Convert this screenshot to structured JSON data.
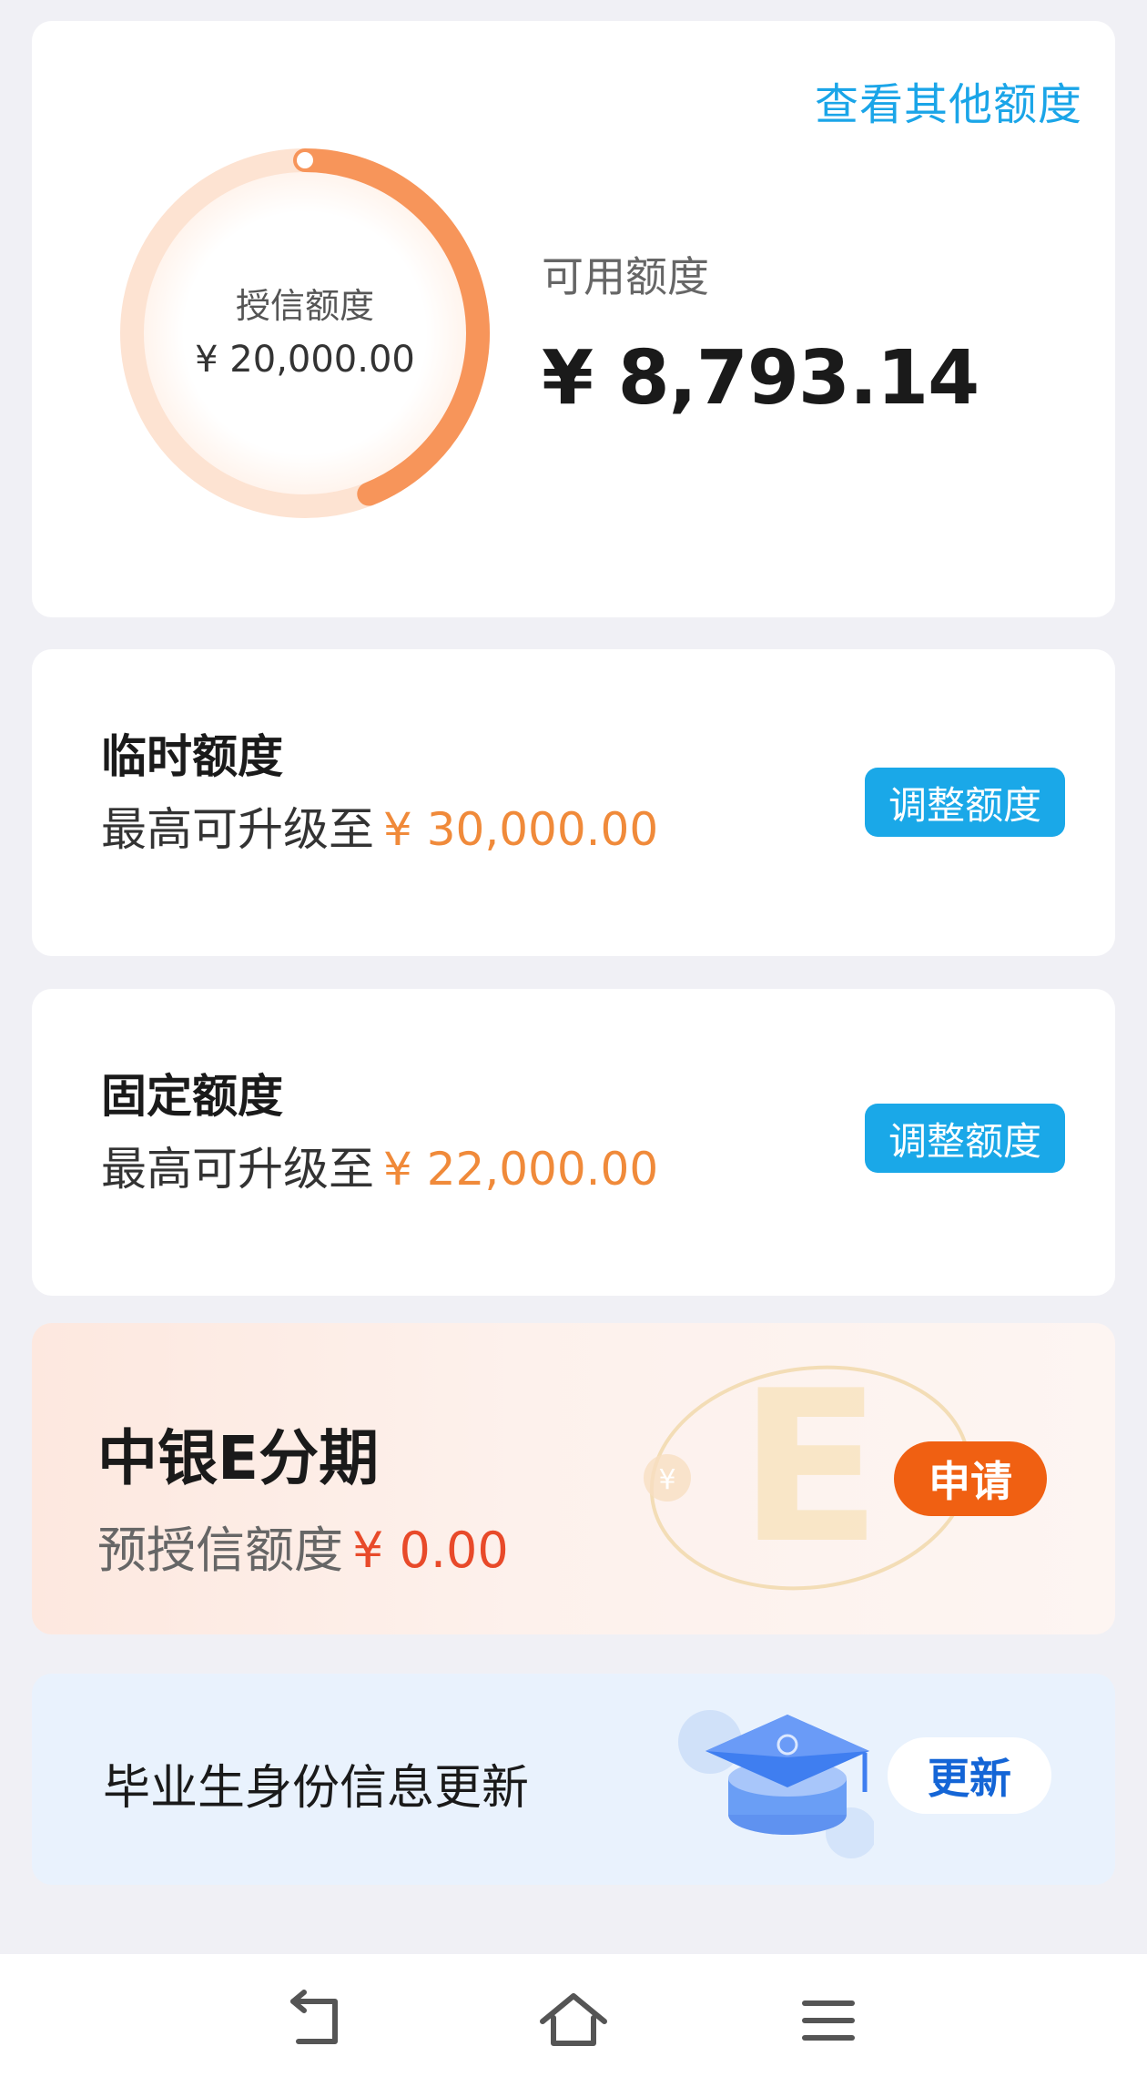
{
  "credit": {
    "other_link": "查看其他额度",
    "credit_label": "授信额度",
    "credit_value": "¥ 20,000.00",
    "available_label": "可用额度",
    "available_value": "¥ 8,793.14",
    "ring_ratio": 0.4397,
    "ring_color": "#f7955a"
  },
  "temp": {
    "title": "临时额度",
    "sub_label": "最高可升级至",
    "amount": "¥ 30,000.00",
    "button": "调整额度"
  },
  "fixed": {
    "title": "固定额度",
    "sub_label": "最高可升级至",
    "amount": "¥ 22,000.00",
    "button": "调整额度"
  },
  "installment": {
    "title": "中银E分期",
    "sub_label": "预授信额度",
    "amount": "¥ 0.00",
    "button": "申请",
    "decoration_letter": "E",
    "decoration_coin": "¥"
  },
  "graduate": {
    "title": "毕业生身份信息更新",
    "button": "更新",
    "icon": "graduation-cap-icon"
  },
  "nav": {
    "back_icon": "back-icon",
    "home_icon": "home-icon",
    "menu_icon": "menu-icon"
  }
}
